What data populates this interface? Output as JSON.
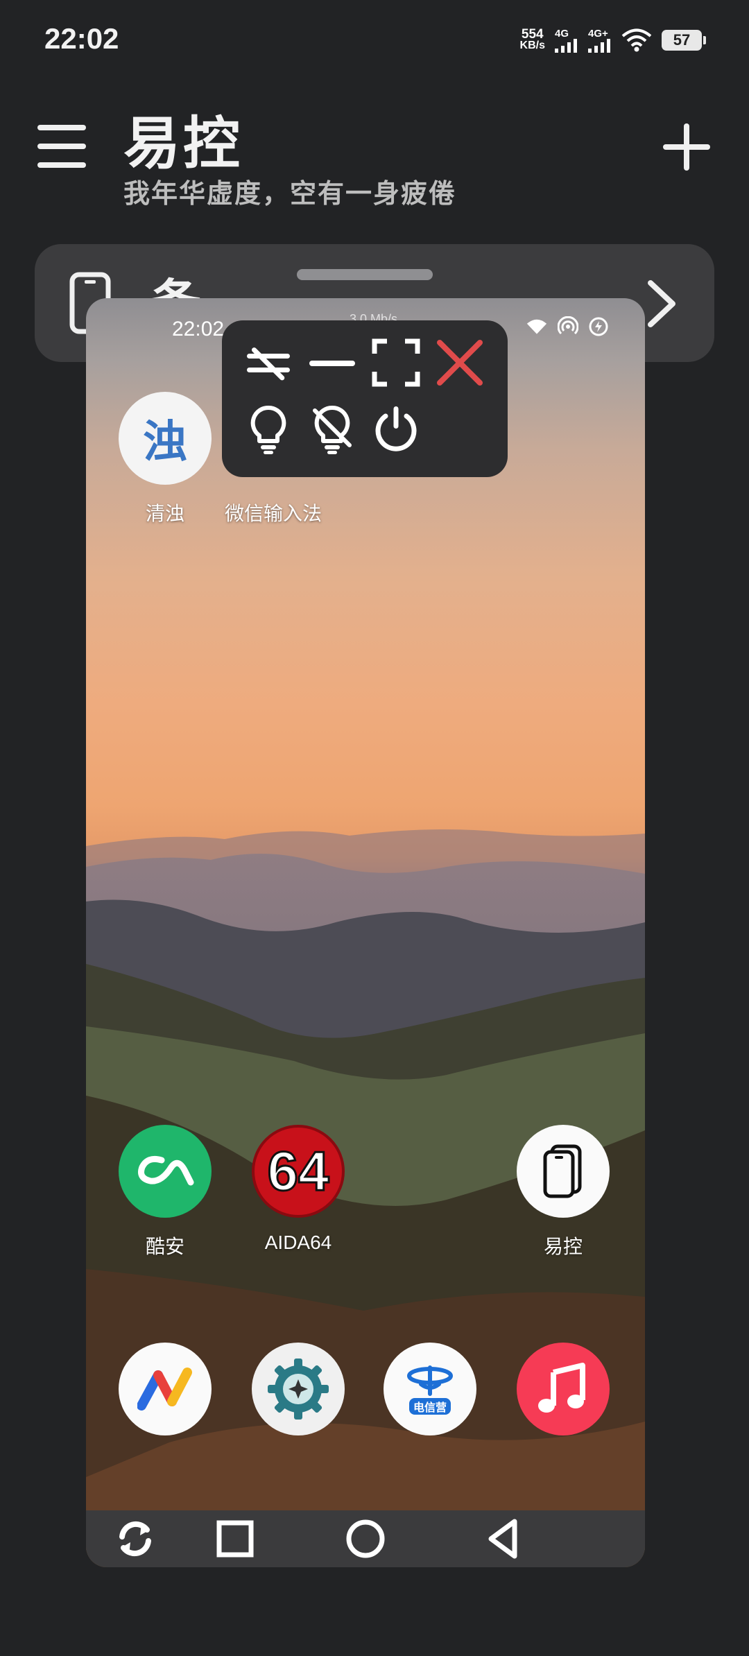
{
  "status_bar": {
    "time": "22:02",
    "net_speed_value": "554",
    "net_speed_unit": "KB/s",
    "signal1_label": "4G",
    "signal2_label": "4G+",
    "battery": "57"
  },
  "header": {
    "title": "易控",
    "subtitle": "我年华虚度，空有一身疲倦"
  },
  "device_card": {
    "label": "备"
  },
  "mirror": {
    "time": "22:02",
    "speed": "3.0 Mb/s",
    "apps_row1": [
      {
        "label": "清浊",
        "icon_text": "浊"
      },
      {
        "label": "微信输入法"
      }
    ],
    "apps_row2": [
      {
        "label": "酷安"
      },
      {
        "label": "AIDA64",
        "icon_text": "64"
      },
      {
        "label": "易控"
      }
    ],
    "dock": [
      {
        "name": "vidhub-icon"
      },
      {
        "name": "settings-gear-icon"
      },
      {
        "name": "telecom-icon",
        "icon_text": "电信营"
      },
      {
        "name": "music-icon"
      }
    ]
  },
  "colors": {
    "background": "#222325",
    "card": "#3c3c3e",
    "toolbar": "#2d2d2f",
    "close_red": "#e04b4b",
    "coolapk_green": "#1fb66b",
    "aida_red": "#c8111a",
    "music_red": "#f63b55"
  }
}
